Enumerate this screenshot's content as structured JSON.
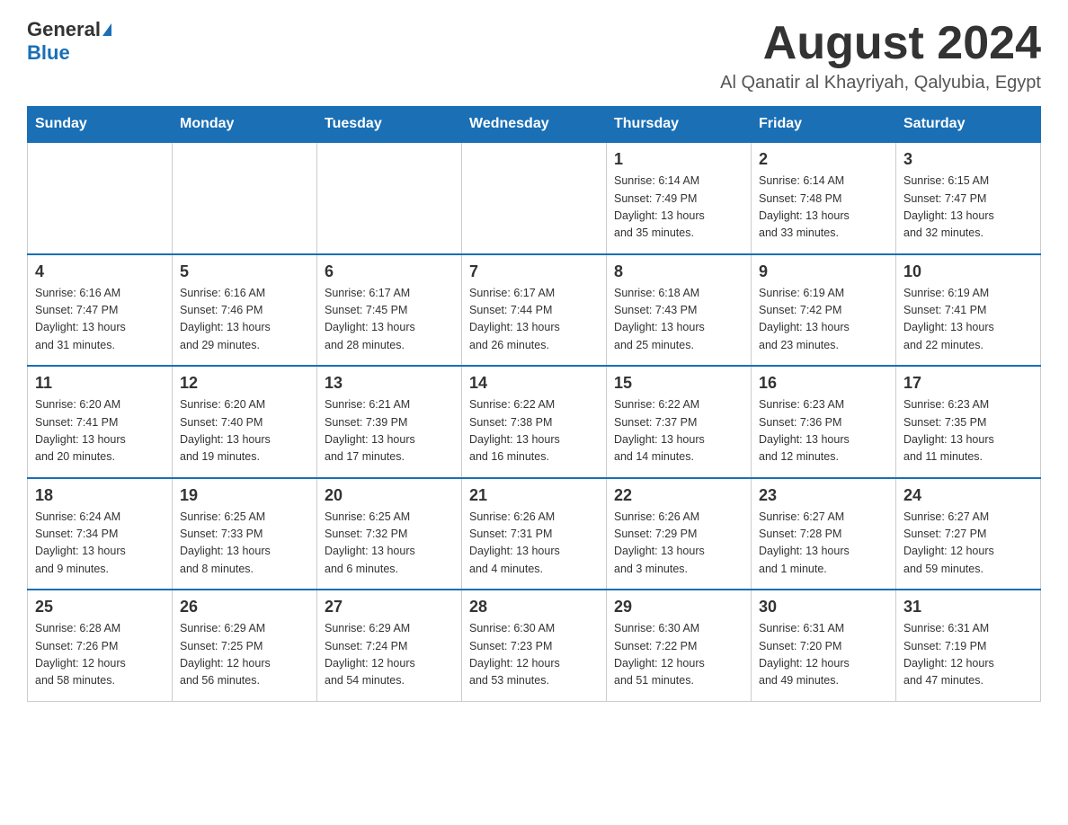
{
  "header": {
    "logo": {
      "general": "General",
      "blue": "Blue",
      "triangle": "▶"
    },
    "title": "August 2024",
    "subtitle": "Al Qanatir al Khayriyah, Qalyubia, Egypt"
  },
  "days_of_week": [
    "Sunday",
    "Monday",
    "Tuesday",
    "Wednesday",
    "Thursday",
    "Friday",
    "Saturday"
  ],
  "weeks": [
    [
      {
        "day": "",
        "info": ""
      },
      {
        "day": "",
        "info": ""
      },
      {
        "day": "",
        "info": ""
      },
      {
        "day": "",
        "info": ""
      },
      {
        "day": "1",
        "info": "Sunrise: 6:14 AM\nSunset: 7:49 PM\nDaylight: 13 hours\nand 35 minutes."
      },
      {
        "day": "2",
        "info": "Sunrise: 6:14 AM\nSunset: 7:48 PM\nDaylight: 13 hours\nand 33 minutes."
      },
      {
        "day": "3",
        "info": "Sunrise: 6:15 AM\nSunset: 7:47 PM\nDaylight: 13 hours\nand 32 minutes."
      }
    ],
    [
      {
        "day": "4",
        "info": "Sunrise: 6:16 AM\nSunset: 7:47 PM\nDaylight: 13 hours\nand 31 minutes."
      },
      {
        "day": "5",
        "info": "Sunrise: 6:16 AM\nSunset: 7:46 PM\nDaylight: 13 hours\nand 29 minutes."
      },
      {
        "day": "6",
        "info": "Sunrise: 6:17 AM\nSunset: 7:45 PM\nDaylight: 13 hours\nand 28 minutes."
      },
      {
        "day": "7",
        "info": "Sunrise: 6:17 AM\nSunset: 7:44 PM\nDaylight: 13 hours\nand 26 minutes."
      },
      {
        "day": "8",
        "info": "Sunrise: 6:18 AM\nSunset: 7:43 PM\nDaylight: 13 hours\nand 25 minutes."
      },
      {
        "day": "9",
        "info": "Sunrise: 6:19 AM\nSunset: 7:42 PM\nDaylight: 13 hours\nand 23 minutes."
      },
      {
        "day": "10",
        "info": "Sunrise: 6:19 AM\nSunset: 7:41 PM\nDaylight: 13 hours\nand 22 minutes."
      }
    ],
    [
      {
        "day": "11",
        "info": "Sunrise: 6:20 AM\nSunset: 7:41 PM\nDaylight: 13 hours\nand 20 minutes."
      },
      {
        "day": "12",
        "info": "Sunrise: 6:20 AM\nSunset: 7:40 PM\nDaylight: 13 hours\nand 19 minutes."
      },
      {
        "day": "13",
        "info": "Sunrise: 6:21 AM\nSunset: 7:39 PM\nDaylight: 13 hours\nand 17 minutes."
      },
      {
        "day": "14",
        "info": "Sunrise: 6:22 AM\nSunset: 7:38 PM\nDaylight: 13 hours\nand 16 minutes."
      },
      {
        "day": "15",
        "info": "Sunrise: 6:22 AM\nSunset: 7:37 PM\nDaylight: 13 hours\nand 14 minutes."
      },
      {
        "day": "16",
        "info": "Sunrise: 6:23 AM\nSunset: 7:36 PM\nDaylight: 13 hours\nand 12 minutes."
      },
      {
        "day": "17",
        "info": "Sunrise: 6:23 AM\nSunset: 7:35 PM\nDaylight: 13 hours\nand 11 minutes."
      }
    ],
    [
      {
        "day": "18",
        "info": "Sunrise: 6:24 AM\nSunset: 7:34 PM\nDaylight: 13 hours\nand 9 minutes."
      },
      {
        "day": "19",
        "info": "Sunrise: 6:25 AM\nSunset: 7:33 PM\nDaylight: 13 hours\nand 8 minutes."
      },
      {
        "day": "20",
        "info": "Sunrise: 6:25 AM\nSunset: 7:32 PM\nDaylight: 13 hours\nand 6 minutes."
      },
      {
        "day": "21",
        "info": "Sunrise: 6:26 AM\nSunset: 7:31 PM\nDaylight: 13 hours\nand 4 minutes."
      },
      {
        "day": "22",
        "info": "Sunrise: 6:26 AM\nSunset: 7:29 PM\nDaylight: 13 hours\nand 3 minutes."
      },
      {
        "day": "23",
        "info": "Sunrise: 6:27 AM\nSunset: 7:28 PM\nDaylight: 13 hours\nand 1 minute."
      },
      {
        "day": "24",
        "info": "Sunrise: 6:27 AM\nSunset: 7:27 PM\nDaylight: 12 hours\nand 59 minutes."
      }
    ],
    [
      {
        "day": "25",
        "info": "Sunrise: 6:28 AM\nSunset: 7:26 PM\nDaylight: 12 hours\nand 58 minutes."
      },
      {
        "day": "26",
        "info": "Sunrise: 6:29 AM\nSunset: 7:25 PM\nDaylight: 12 hours\nand 56 minutes."
      },
      {
        "day": "27",
        "info": "Sunrise: 6:29 AM\nSunset: 7:24 PM\nDaylight: 12 hours\nand 54 minutes."
      },
      {
        "day": "28",
        "info": "Sunrise: 6:30 AM\nSunset: 7:23 PM\nDaylight: 12 hours\nand 53 minutes."
      },
      {
        "day": "29",
        "info": "Sunrise: 6:30 AM\nSunset: 7:22 PM\nDaylight: 12 hours\nand 51 minutes."
      },
      {
        "day": "30",
        "info": "Sunrise: 6:31 AM\nSunset: 7:20 PM\nDaylight: 12 hours\nand 49 minutes."
      },
      {
        "day": "31",
        "info": "Sunrise: 6:31 AM\nSunset: 7:19 PM\nDaylight: 12 hours\nand 47 minutes."
      }
    ]
  ]
}
